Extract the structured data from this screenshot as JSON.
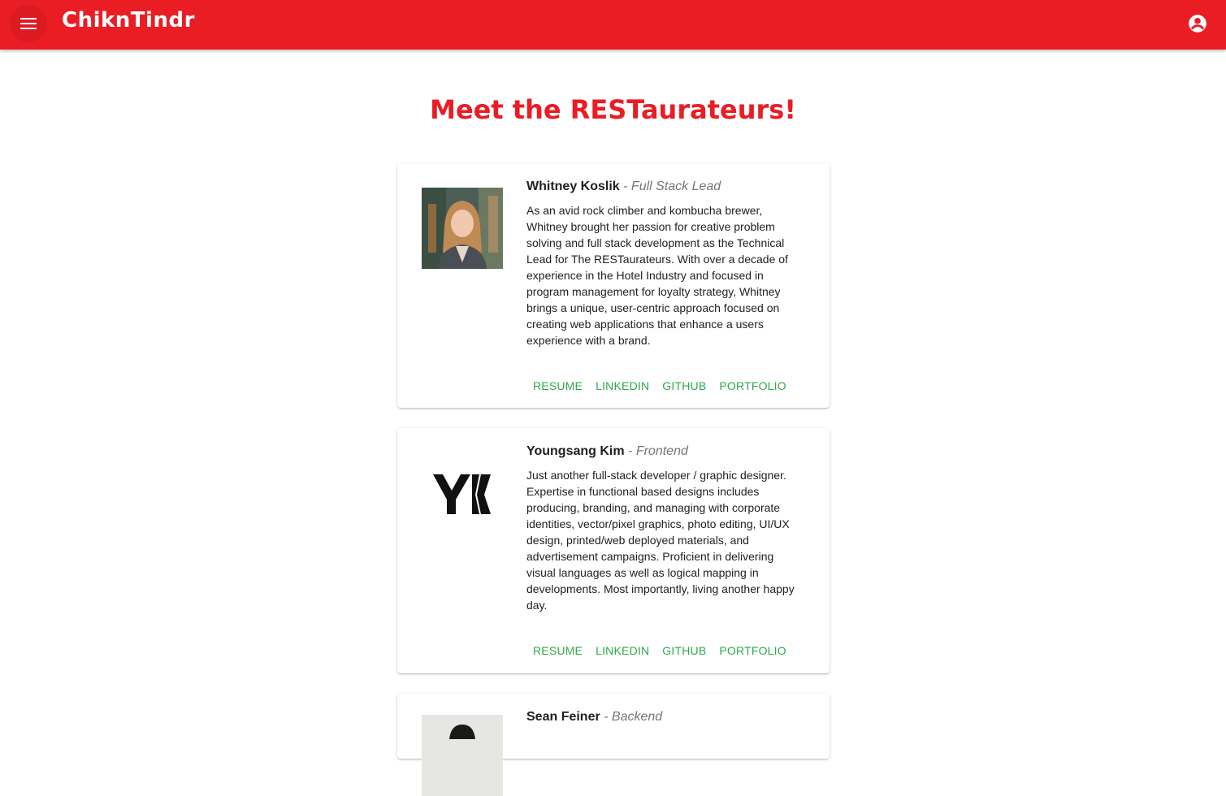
{
  "app": {
    "title": "ChiknTindr",
    "menu_icon": "menu-icon",
    "account_icon": "account-circle-icon",
    "brand_color": "#ea1c24",
    "link_color": "#2ea84a"
  },
  "page": {
    "title": "Meet the RESTaurateurs!"
  },
  "team": [
    {
      "name": "Whitney Koslik",
      "role": "- Full Stack Lead",
      "bio": "As an avid rock climber and kombucha brewer, Whitney brought her passion for creative problem solving and full stack development as the Technical Lead for The RESTaurateurs. With over a decade of experience in the Hotel Industry and focused in program management for loyalty strategy, Whitney brings a unique, user-centric approach focused on creating web applications that enhance a users experience with a brand.",
      "links": [
        "RESUME",
        "LINKEDIN",
        "GITHUB",
        "PORTFOLIO"
      ]
    },
    {
      "name": "Youngsang Kim",
      "role": "- Frontend",
      "bio": "Just another full-stack developer / graphic designer. Expertise in functional based designs includes producing, branding, and managing with corporate identities, vector/pixel graphics, photo editing, UI/UX design, printed/web deployed materials, and advertisement campaigns. Proficient in delivering visual languages as well as logical mapping in developments. Most importantly, living another happy day.",
      "links": [
        "RESUME",
        "LINKEDIN",
        "GITHUB",
        "PORTFOLIO"
      ]
    },
    {
      "name": "Sean Feiner",
      "role": "- Backend"
    }
  ]
}
